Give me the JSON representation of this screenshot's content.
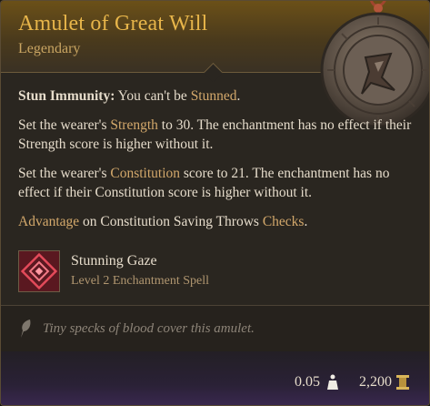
{
  "item": {
    "name": "Amulet of Great Will",
    "rarity": "Legendary",
    "image_icon": "amulet-icon"
  },
  "effects": {
    "stun": {
      "label": "Stun Immunity:",
      "text_before": " You can't be ",
      "keyword": "Stunned",
      "text_after": "."
    },
    "strength": {
      "text_before": "Set the wearer's ",
      "keyword": "Strength",
      "text_after": " to 30. The enchantment has no effect if their Strength score is higher without it."
    },
    "constitution": {
      "text_before": "Set the wearer's ",
      "keyword": "Constitution",
      "text_after": " score to 21. The enchantment has no effect if their Constitution score is higher without it."
    },
    "advantage": {
      "keyword": "Advantage",
      "text_middle": " on Constitution Saving Throws ",
      "keyword2": "Checks",
      "text_after": "."
    }
  },
  "spell": {
    "name": "Stunning Gaze",
    "subtitle": "Level 2 Enchantment Spell",
    "icon": "stunning-gaze-icon"
  },
  "flavor": {
    "text": "Tiny specks of blood cover this amulet.",
    "icon": "quill-icon"
  },
  "footer": {
    "weight": "0.05",
    "weight_icon": "weight-icon",
    "value": "2,200",
    "value_icon": "gold-coin-icon"
  },
  "colors": {
    "title": "#e7b54a",
    "keyword": "#d3a86b",
    "body_text": "#e6dccb",
    "flavor_text": "#8d8478"
  }
}
